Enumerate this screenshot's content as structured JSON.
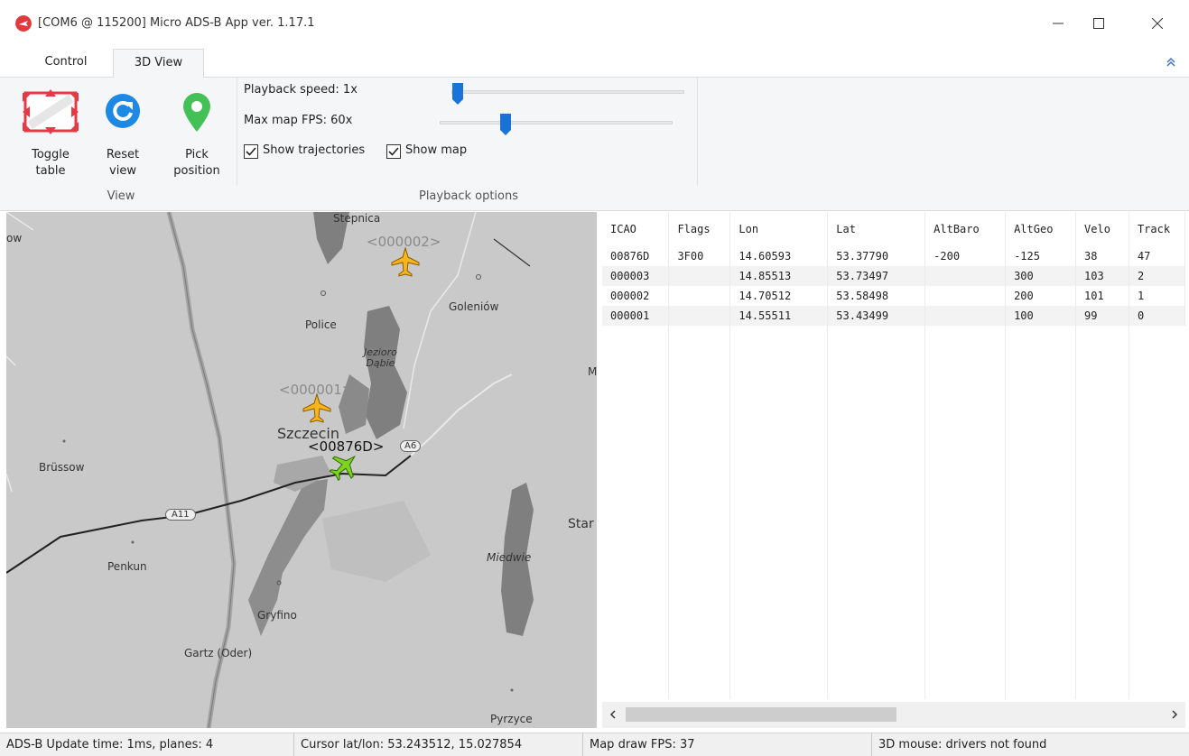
{
  "window": {
    "title": "[COM6 @ 115200] Micro ADS-B App ver. 1.17.1",
    "accent_color": "#e0393e"
  },
  "tabs": [
    {
      "label": "Control",
      "active": false
    },
    {
      "label": "3D View",
      "active": true
    }
  ],
  "ribbon": {
    "view_group": {
      "label": "View",
      "buttons": [
        {
          "label": "Toggle\ntable",
          "icon": "toggle-table-icon"
        },
        {
          "label": "Reset\nview",
          "icon": "reset-view-icon"
        },
        {
          "label": "Pick\nposition",
          "icon": "location-pin-icon"
        }
      ]
    },
    "playback_group": {
      "label": "Playback options",
      "speed_label": "Playback speed:  1x",
      "speed_value": 0,
      "fps_label": "Max map FPS:  60x",
      "fps_value": 0.28,
      "show_trajectories_label": "Show trajectories",
      "show_trajectories_checked": true,
      "show_map_label": "Show map",
      "show_map_checked": true
    }
  },
  "map": {
    "places": [
      "Stepnica",
      "Goleniów",
      "Police",
      "Jezioro\nDąbie",
      "Szczecin",
      "Brüssow",
      "Penkun",
      "Gryfino",
      "Gartz (Oder)",
      "Pyrzyce",
      "Miedwie",
      "Star",
      "ow",
      "M"
    ],
    "road_labels": [
      "A11",
      "A6"
    ],
    "aircraft": [
      {
        "callsign": "<000002>",
        "color": "#f7b51c"
      },
      {
        "callsign": "<000001>",
        "color": "#f7b51c"
      },
      {
        "callsign": "<00876D>",
        "color": "#7ed321"
      }
    ]
  },
  "table": {
    "columns": [
      "ICAO",
      "Flags",
      "Lon",
      "Lat",
      "AltBaro",
      "AltGeo",
      "Velo",
      "Track"
    ],
    "rows": [
      [
        "00876D",
        "3F00",
        "14.60593",
        "53.37790",
        "-200",
        "-125",
        "38",
        "47"
      ],
      [
        "000003",
        "",
        "14.85513",
        "53.73497",
        "",
        "300",
        "103",
        "2"
      ],
      [
        "000002",
        "",
        "14.70512",
        "53.58498",
        "",
        "200",
        "101",
        "1"
      ],
      [
        "000001",
        "",
        "14.55511",
        "53.43499",
        "",
        "100",
        "99",
        "0"
      ]
    ]
  },
  "status": {
    "update": "ADS-B Update time: 1ms, planes: 4",
    "cursor": "Cursor lat/lon: 53.243512, 15.027854",
    "fps": "Map draw FPS: 37",
    "mouse": "3D mouse: drivers not found"
  }
}
